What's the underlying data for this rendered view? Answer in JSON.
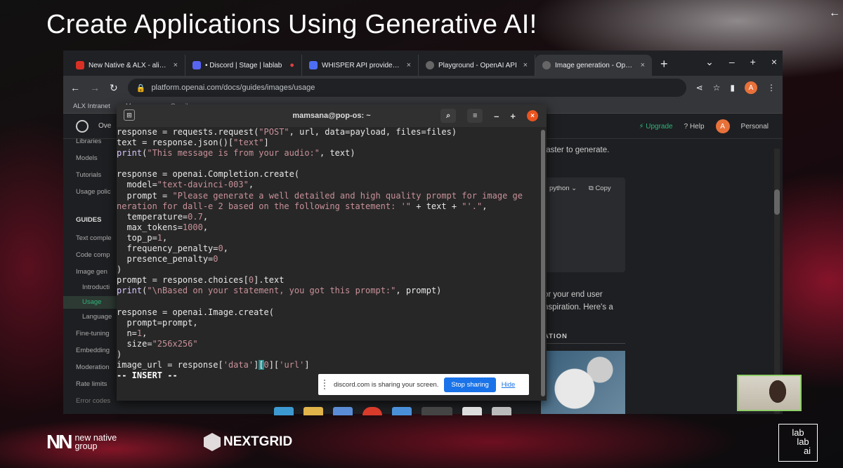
{
  "slide": {
    "title": "Create Applications Using Generative AI!",
    "corner_arrow": "←"
  },
  "browser": {
    "tabs": [
      {
        "title": "New Native & ALX - alicemi",
        "fav_color": "#d93025",
        "active": false
      },
      {
        "title": "• Discord | Stage | lablab",
        "fav_color": "#5865f2",
        "active": false
      },
      {
        "title": "WHISPER API provided by l",
        "fav_color": "#4c6ef5",
        "active": false
      },
      {
        "title": "Playground - OpenAI API",
        "fav_color": "#666666",
        "active": false
      },
      {
        "title": "Image generation - OpenAI",
        "fav_color": "#666666",
        "active": true
      }
    ],
    "new_tab": "+",
    "url": "platform.openai.com/docs/guides/images/usage",
    "profile_initial": "A",
    "bookmarks": [
      "ALX Intranet",
      "Mamsana",
      "Gmail"
    ]
  },
  "openai_page": {
    "nav": {
      "brand_partial": "Ove",
      "upgrade": "Upgrade",
      "help": "Help",
      "personal": "Personal",
      "avatar": "A"
    },
    "sidebar": {
      "libraries": "Libraries",
      "models": "Models",
      "tutorials": "Tutorials",
      "usage_policies": "Usage polic",
      "guides_header": "GUIDES",
      "text_completion": "Text comple",
      "code_completion": "Code comp",
      "image_generation": "Image gen",
      "introduction": "Introducti",
      "usage": "Usage",
      "language": "Language",
      "fine_tuning": "Fine-tuning",
      "embeddings": "Embedding",
      "moderation": "Moderation",
      "rate_limits": "Rate limits",
      "error_codes": "Error codes"
    },
    "content": {
      "line1": "faster to generate.",
      "code_lang": "python",
      "copy": "Copy",
      "line2": "or your end user",
      "line3": "nspiration. Here's a",
      "section": "ATION"
    }
  },
  "terminal": {
    "title": "mamsana@pop-os: ~",
    "mode": "-- INSERT --"
  },
  "share_bar": {
    "message": "discord.com is sharing your screen.",
    "stop": "Stop sharing",
    "hide": "Hide"
  },
  "footer": {
    "newnative": "new native\ngroup",
    "newnative_l1": "new native",
    "newnative_l2": "group",
    "nextgrid": "NEXTGRID",
    "lablab_l1": "lab",
    "lablab_l2": "lab",
    "lablab_l3": "ai"
  }
}
